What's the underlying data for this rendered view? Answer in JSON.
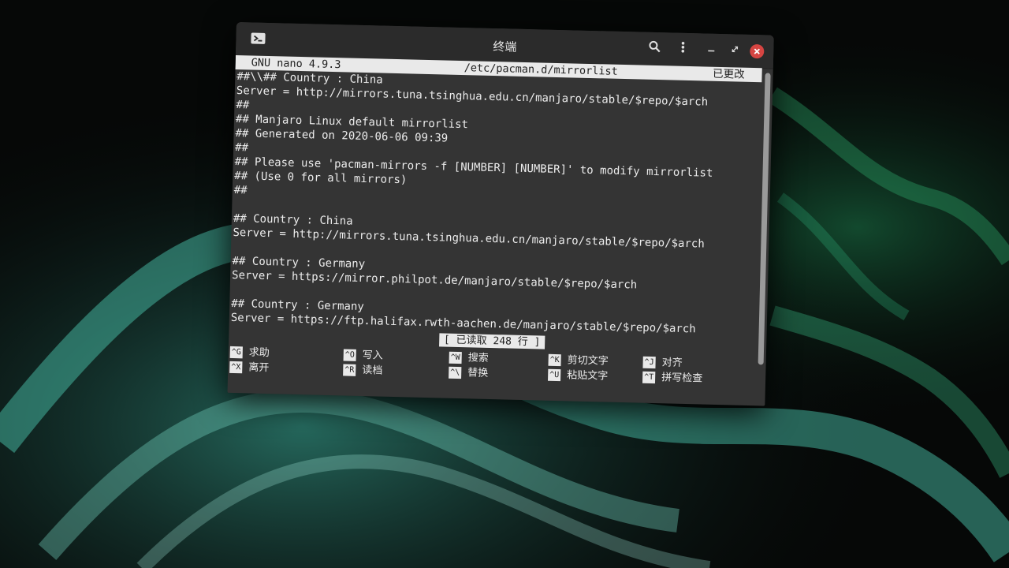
{
  "window": {
    "title": "终端"
  },
  "titlebar_icons": {
    "app": "terminal-icon",
    "search": "search-icon",
    "menu": "kebab-menu-icon",
    "minimize": "minimize-icon",
    "maximize": "maximize-icon",
    "close": "close-icon"
  },
  "nano": {
    "version": "GNU nano 4.9.3",
    "filename": "/etc/pacman.d/mirrorlist",
    "modified": "已更改",
    "status": "[ 已读取 248 行 ]"
  },
  "lines": [
    "##\\\\## Country : China",
    "Server = http://mirrors.tuna.tsinghua.edu.cn/manjaro/stable/$repo/$arch",
    "##",
    "## Manjaro Linux default mirrorlist",
    "## Generated on 2020-06-06 09:39",
    "##",
    "## Please use 'pacman-mirrors -f [NUMBER] [NUMBER]' to modify mirrorlist",
    "## (Use 0 for all mirrors)",
    "##",
    "",
    "## Country : China",
    "Server = http://mirrors.tuna.tsinghua.edu.cn/manjaro/stable/$repo/$arch",
    "",
    "## Country : Germany",
    "Server = https://mirror.philpot.de/manjaro/stable/$repo/$arch",
    "",
    "## Country : Germany",
    "Server = https://ftp.halifax.rwth-aachen.de/manjaro/stable/$repo/$arch"
  ],
  "shortcuts": [
    {
      "key": "^G",
      "label": "求助"
    },
    {
      "key": "^X",
      "label": "离开"
    },
    {
      "key": "^O",
      "label": "写入"
    },
    {
      "key": "^R",
      "label": "读档"
    },
    {
      "key": "^W",
      "label": "搜索"
    },
    {
      "key": "^\\",
      "label": "替换"
    },
    {
      "key": "^K",
      "label": "剪切文字"
    },
    {
      "key": "^U",
      "label": "粘贴文字"
    },
    {
      "key": "^J",
      "label": "对齐"
    },
    {
      "key": "^T",
      "label": "拼写检查"
    }
  ],
  "colors": {
    "terminal_bg": "#343434",
    "titlebar_bg": "#2b2b2b",
    "close_button": "#d64542",
    "wallpaper_swirl": "#3fb8a4"
  }
}
